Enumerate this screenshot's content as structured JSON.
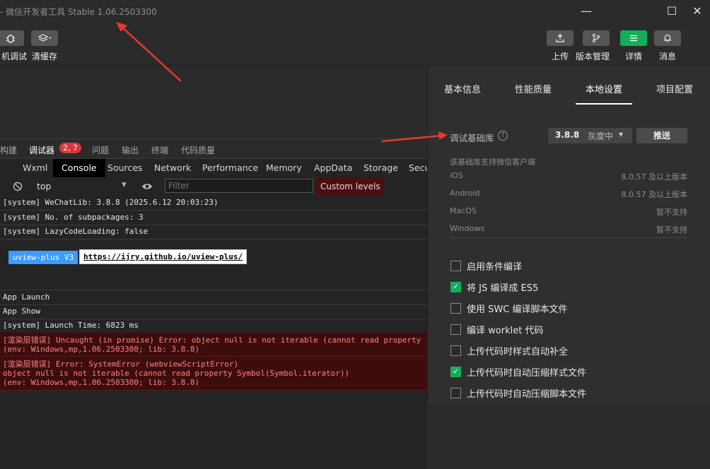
{
  "window": {
    "title": "- 微信开发者工具 Stable 1.06.2503300",
    "controls": {
      "minimize": "—",
      "maximize": "☐",
      "close": "✕"
    }
  },
  "toolbar": {
    "left": [
      {
        "label": "机调试",
        "icon": "bug-icon"
      },
      {
        "label": "清缓存",
        "icon": "layers-icon"
      }
    ],
    "right": [
      {
        "label": "上传",
        "icon": "upload-icon"
      },
      {
        "label": "版本管理",
        "icon": "branch-icon"
      },
      {
        "label": "详情",
        "icon": "menu-icon"
      },
      {
        "label": "消息",
        "icon": "bell-icon"
      }
    ]
  },
  "debugger_tabs": {
    "items": [
      "构建",
      "调试器",
      "问题",
      "输出",
      "终端",
      "代码质量"
    ],
    "badge": "2, 7"
  },
  "panel_tabs": [
    "Wxml",
    "Console",
    "Sources",
    "Network",
    "Performance",
    "Memory",
    "AppData",
    "Storage",
    "Secu"
  ],
  "filterbar": {
    "context": "top",
    "filter_placeholder": "Filter",
    "levels": "Custom levels"
  },
  "console": {
    "lines": [
      "[system] WeChatLib: 3.8.8 (2025.6.12 20:03:23)",
      "[system] No. of subpackages: 3",
      "[system] LazyCodeLoading: false"
    ],
    "uview_tag": "uview-plus V3",
    "uview_link": "https://ijry.github.io/uview-plus/",
    "lines2": [
      "App Launch",
      "App Show",
      "[system] Launch Time: 6823 ms"
    ],
    "error1": [
      "[渲染层错误] Uncaught (in promise) Error: object null is not iterable (cannot read property",
      "(env: Windows,mp,1.06.2503300; lib: 3.8.8)"
    ],
    "error2": [
      "[渲染层错误] Error: SystemError (webviewScriptError)",
      "object null is not iterable (cannot read property Symbol(Symbol.iterator))",
      "(env: Windows,mp,1.06.2503300; lib: 3.8.8)"
    ]
  },
  "right_panel": {
    "tabs": [
      "基本信息",
      "性能质量",
      "本地设置",
      "项目配置"
    ],
    "active_tab": "本地设置",
    "lib_label": "调试基础库",
    "lib_version": "3.8.8",
    "lib_status": "灰度中",
    "push_label": "推送",
    "support_title": "该基础库支持微信客户端",
    "support": [
      {
        "os": "iOS",
        "value": "8.0.57 及以上版本"
      },
      {
        "os": "Android",
        "value": "8.0.57 及以上版本"
      },
      {
        "os": "MacOS",
        "value": "暂不支持"
      },
      {
        "os": "Windows",
        "value": "暂不支持"
      }
    ],
    "options": [
      {
        "label": "启用条件编译",
        "checked": false
      },
      {
        "label": "将 JS 编译成 ES5",
        "checked": true
      },
      {
        "label": "使用 SWC 编译脚本文件",
        "checked": false
      },
      {
        "label": "编译 worklet 代码",
        "checked": false
      },
      {
        "label": "上传代码时样式自动补全",
        "checked": false
      },
      {
        "label": "上传代码时自动压缩样式文件",
        "checked": true
      },
      {
        "label": "上传代码时自动压缩脚本文件",
        "checked": false
      }
    ]
  },
  "colors": {
    "accent_green": "#16ad5a",
    "badge_red": "#d8383d",
    "arrow_red": "#e53a2d"
  }
}
